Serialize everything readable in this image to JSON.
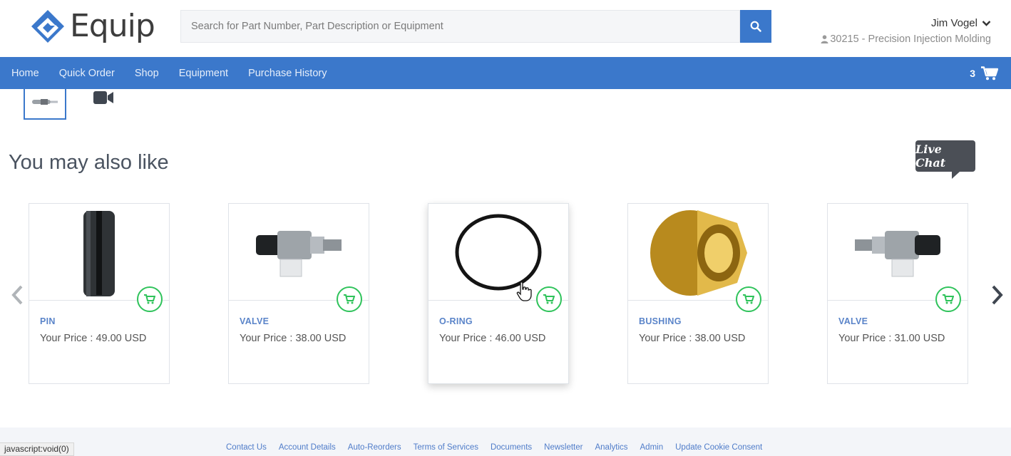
{
  "brand": {
    "name": "Equip",
    "color": "#3b78cb"
  },
  "search": {
    "placeholder": "Search for Part Number, Part Description or Equipment"
  },
  "user": {
    "name": "Jim Vogel",
    "company": "30215 - Precision Injection Molding"
  },
  "nav": {
    "items": [
      "Home",
      "Quick Order",
      "Shop",
      "Equipment",
      "Purchase History"
    ]
  },
  "cart": {
    "count": "3"
  },
  "section": {
    "title": "You may also like"
  },
  "live_chat": {
    "label": "Live Chat"
  },
  "products": [
    {
      "name": "PIN",
      "price": "Your Price : 49.00 USD",
      "icon": "pin-image"
    },
    {
      "name": "VALVE",
      "price": "Your Price : 38.00 USD",
      "icon": "valve-image"
    },
    {
      "name": "O-RING",
      "price": "Your Price : 46.00 USD",
      "icon": "o-ring-image"
    },
    {
      "name": "BUSHING",
      "price": "Your Price : 38.00 USD",
      "icon": "bushing-image"
    },
    {
      "name": "VALVE",
      "price": "Your Price : 31.00 USD",
      "icon": "valve-image"
    }
  ],
  "footer": {
    "links": [
      "Contact Us",
      "Account Details",
      "Auto-Reorders",
      "Terms of Services",
      "Documents",
      "Newsletter",
      "Analytics",
      "Admin",
      "Update Cookie Consent"
    ]
  },
  "status_bar": {
    "text": "javascript:void(0)"
  },
  "colors": {
    "nav_bg": "#3b78cb",
    "add_to_cart": "#2fc35b",
    "product_name": "#5a84c9"
  }
}
